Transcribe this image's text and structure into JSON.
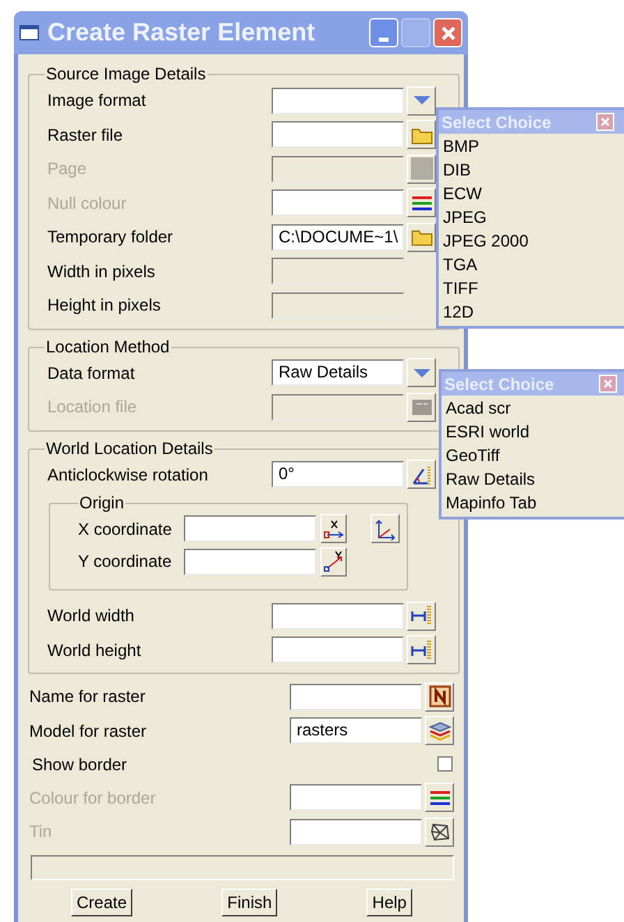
{
  "window": {
    "title": "Create Raster Element"
  },
  "sections": [
    {
      "title": "Source Image Details",
      "rows": [
        {
          "kind": "choice",
          "label": "Image format",
          "disabled": false
        },
        {
          "kind": "file",
          "label": "Raster file",
          "disabled": false
        },
        {
          "kind": "page",
          "label": "Page",
          "disabled": true
        },
        {
          "kind": "colour",
          "label": "Null colour",
          "disabled": true
        },
        {
          "kind": "file",
          "label": "Temporary folder",
          "disabled": false,
          "value": "C:\\DOCUME~1\\"
        },
        {
          "kind": "readout",
          "label": "Width in pixels",
          "disabled": false
        },
        {
          "kind": "readout",
          "label": "Height in pixels",
          "disabled": false
        }
      ]
    },
    {
      "title": "Location Method",
      "rows": [
        {
          "kind": "choice",
          "label": "Data format",
          "disabled": false,
          "value": "Raw Details"
        },
        {
          "kind": "locked-file",
          "label": "Location file",
          "disabled": true
        }
      ]
    },
    {
      "title": "World Location Details",
      "rows": [
        {
          "kind": "angle",
          "label": "Anticlockwise rotation",
          "disabled": false,
          "value": "0°"
        },
        {
          "kind": "group",
          "title": "Origin",
          "rows": [
            {
              "kind": "x-coord",
              "label": "X coordinate",
              "disabled": false
            },
            {
              "kind": "y-coord",
              "label": "Y coordinate",
              "disabled": false
            }
          ]
        },
        {
          "kind": "distance",
          "label": "World width",
          "disabled": false
        },
        {
          "kind": "distance",
          "label": "World height",
          "disabled": false
        }
      ]
    }
  ],
  "fields": [
    {
      "kind": "name",
      "label": "Name for raster",
      "disabled": false
    },
    {
      "kind": "model",
      "label": "Model for raster",
      "disabled": false,
      "value": "rasters"
    },
    {
      "kind": "checkbox",
      "label": "Show border",
      "disabled": false,
      "checked": false
    },
    {
      "kind": "colour",
      "label": "Colour for border",
      "disabled": true
    },
    {
      "kind": "tin",
      "label": "Tin",
      "disabled": true
    }
  ],
  "buttons": [
    "Create",
    "Finish",
    "Help"
  ],
  "popups": [
    {
      "title": "Select Choice",
      "items": [
        "BMP",
        "DIB",
        "ECW",
        "JPEG",
        "JPEG 2000",
        "TGA",
        "TIFF",
        "12D"
      ]
    },
    {
      "title": "Select Choice",
      "items": [
        "Acad scr",
        "ESRI world",
        "GeoTiff",
        "Raw Details",
        "Mapinfo Tab"
      ]
    }
  ]
}
